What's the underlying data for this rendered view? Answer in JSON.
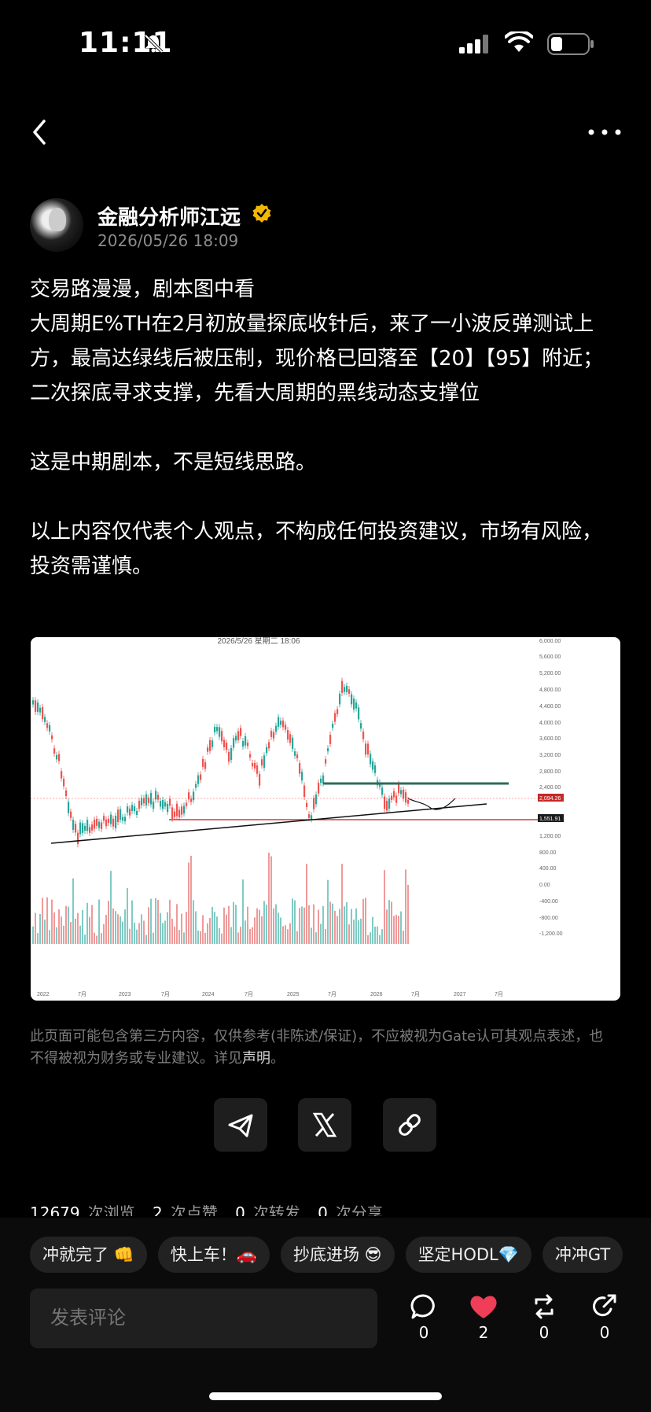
{
  "status_bar": {
    "time": "11:11"
  },
  "author": {
    "name": "金融分析师江远",
    "date": "2026/05/26 18:09"
  },
  "post": {
    "text": "交易路漫漫，剧本图中看\n大周期E%TH在2月初放量探底收针后，来了一小波反弹测试上方，最高达绿线后被压制，现价格已回落至【20】【95】附近；二次探底寻求支撑，先看大周期的黑线动态支撑位\n\n这是中期剧本，不是短线思路。\n\n以上内容仅代表个人观点，不构成任何投资建议，市场有风险，投资需谨慎。"
  },
  "chart": {
    "header": "2026/5/26 星期二 18:06",
    "price_labels": [
      "6,000.00",
      "5,600.00",
      "5,200.00",
      "4,800.00",
      "4,400.00",
      "4,000.00",
      "3,600.00",
      "3,200.00",
      "2,800.00",
      "2,400.00",
      "1,200.00",
      "800.00",
      "400.00",
      "0.00",
      "-400.00",
      "-800.00",
      "-1,200.00"
    ],
    "price_label": "2,094.26",
    "support_label": "1,551.91",
    "x_labels": [
      "2022",
      "7月",
      "2023",
      "7月",
      "2024",
      "7月",
      "2025",
      "7月",
      "2026",
      "7月",
      "2027",
      "7月"
    ],
    "colors": {
      "up": "#26a69a",
      "down": "#ef5350",
      "resistance": "#2e6b5e",
      "support": "#b71c1c"
    }
  },
  "disclaimer": {
    "text": "此页面可能包含第三方内容，仅供参考(非陈述/保证)，不应被视为Gate认可其观点表述，也不得被视为财务或专业建议。详见",
    "link": "声明",
    "end": "。"
  },
  "stats": {
    "views": "12679",
    "views_label": "次浏览",
    "likes": "2",
    "likes_label": "次点赞",
    "reposts": "0",
    "reposts_label": "次转发",
    "shares": "0",
    "shares_label": "次分享"
  },
  "quick_replies": [
    "冲就完了 👊",
    "快上车！🚗",
    "抄底进场 😎",
    "坚定HODL💎",
    "冲冲GT"
  ],
  "comment": {
    "placeholder": "发表评论"
  },
  "actions": {
    "comment_count": "0",
    "like_count": "2",
    "repost_count": "0",
    "share_count": "0"
  },
  "icons": [
    "bell-mute-icon",
    "signal-icon",
    "wifi-icon",
    "battery-icon",
    "back-icon",
    "more-icon",
    "verified-icon",
    "telegram-icon",
    "x-icon",
    "link-icon",
    "comment-icon",
    "heart-icon",
    "repost-icon",
    "share-icon"
  ]
}
